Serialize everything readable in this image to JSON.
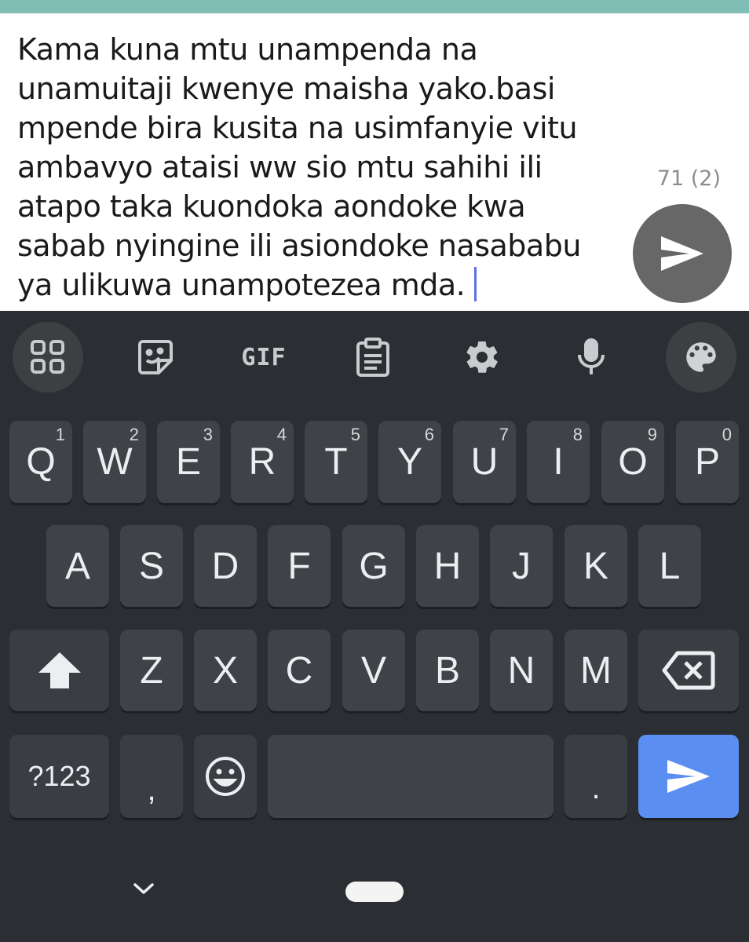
{
  "compose": {
    "lines": [
      "Kama kuna mtu unampenda na",
      "unamuitaji kwenye maisha yako.basi",
      "mpende bira kusita na usimfanyie vitu",
      "ambavyo ataisi ww sio mtu sahihi ili",
      "atapo taka kuondoka aondoke kwa",
      "sabab nyingine ili asiondoke nasababu",
      "ya ulikuwa unampotezea mda."
    ],
    "char_counter": "71 (2)",
    "send_icon": "send-icon"
  },
  "toolbar": {
    "items": [
      "apps-grid-icon",
      "sticker-icon",
      "GIF",
      "clipboard-icon",
      "gear-icon",
      "microphone-icon",
      "palette-icon"
    ]
  },
  "keyboard": {
    "row1": [
      {
        "key": "Q",
        "hint": "1"
      },
      {
        "key": "W",
        "hint": "2"
      },
      {
        "key": "E",
        "hint": "3"
      },
      {
        "key": "R",
        "hint": "4"
      },
      {
        "key": "T",
        "hint": "5"
      },
      {
        "key": "Y",
        "hint": "6"
      },
      {
        "key": "U",
        "hint": "7"
      },
      {
        "key": "I",
        "hint": "8"
      },
      {
        "key": "O",
        "hint": "9"
      },
      {
        "key": "P",
        "hint": "0"
      }
    ],
    "row2": [
      "A",
      "S",
      "D",
      "F",
      "G",
      "H",
      "J",
      "K",
      "L"
    ],
    "row3": [
      "Z",
      "X",
      "C",
      "V",
      "B",
      "N",
      "M"
    ],
    "symbols_label": "?123",
    "comma": ",",
    "period": ".",
    "shift_icon": "shift-icon",
    "backspace_icon": "backspace-icon",
    "emoji_icon": "emoji-icon",
    "enter_icon": "send-icon",
    "enter_color": "#5a8ef0"
  },
  "navbar": {
    "hide_icon": "chevron-down-icon",
    "home_icon": "home-pill"
  }
}
